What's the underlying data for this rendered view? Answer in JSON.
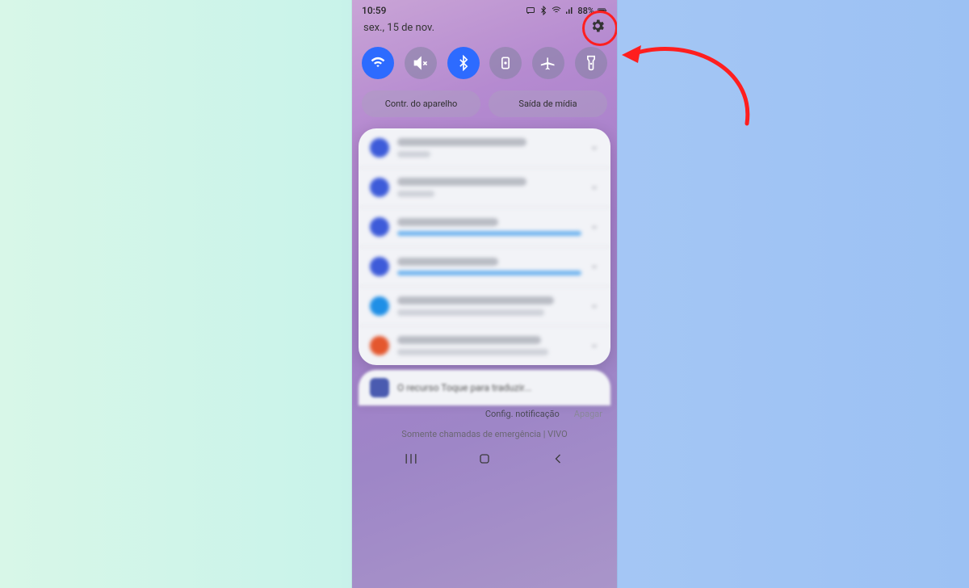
{
  "statusbar": {
    "time": "10:59",
    "battery": "88%"
  },
  "header": {
    "date": "sex., 15 de nov."
  },
  "quick_toggles": [
    {
      "name": "wifi",
      "active": true
    },
    {
      "name": "mute",
      "active": false
    },
    {
      "name": "bluetooth",
      "active": true
    },
    {
      "name": "screen-lock",
      "active": false
    },
    {
      "name": "airplane",
      "active": false
    },
    {
      "name": "flashlight",
      "active": false
    }
  ],
  "pills": {
    "device_control": "Contr. do aparelho",
    "media_output": "Saída de mídia"
  },
  "notifications": [
    {
      "icon_color": "#3d5bd9",
      "kind": "text",
      "title_w": 70,
      "sub_w": 18
    },
    {
      "icon_color": "#3d5bd9",
      "kind": "text",
      "title_w": 70,
      "sub_w": 20
    },
    {
      "icon_color": "#3d5bd9",
      "kind": "progress",
      "title_w": 55
    },
    {
      "icon_color": "#3d5bd9",
      "kind": "progress",
      "title_w": 55
    },
    {
      "icon_color": "#1f8fe6",
      "kind": "text",
      "title_w": 85,
      "sub_w": 80
    },
    {
      "icon_color": "#e4572e",
      "kind": "text",
      "title_w": 78,
      "sub_w": 82
    }
  ],
  "peek_notification": {
    "text": "O recurso Toque para traduzir..."
  },
  "footer": {
    "config": "Config. notificação",
    "clear": "Apagar",
    "emergency": "Somente chamadas de emergência | VIVO"
  },
  "annotation": {
    "target": "settings-gear",
    "color": "#ff1f1f"
  }
}
